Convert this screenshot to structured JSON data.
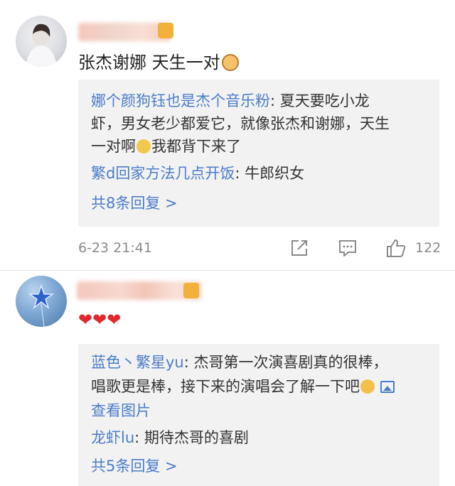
{
  "comment1": {
    "text": "张杰谢娜 天生一对",
    "emoji": "cat-face-emoji",
    "replies": {
      "reply1_name": "娜个颜狗钰也是杰个音乐粉",
      "reply1_line1": ": 夏天要吃小龙",
      "reply1_line2": "虾，男女老少都爱它，就像张杰和谢娜，天生",
      "reply1_line3a": "一对啊",
      "reply1_line3b": "我都背下来了",
      "reply2_name": "繁d回家方法几点开饭",
      "reply2_text": ": 牛郎织女",
      "more": "共8条回复 >"
    },
    "date": "6-23 21:41",
    "like_count": "122"
  },
  "comment2": {
    "text": "❤❤❤",
    "replies": {
      "reply1_name": "蓝色丶繁星yu",
      "reply1_line1": ": 杰哥第一次演喜剧真的很棒，",
      "reply1_line2": "唱歌更是棒，接下来的演唱会了解一下吧",
      "reply1_line3": "查看图片",
      "reply2_name": "龙虾lu",
      "reply2_text": ": 期待杰哥的喜剧",
      "more": "共5条回复 >"
    }
  },
  "colors": {
    "link": "#4b7cc9",
    "heart": "#e0282e",
    "reply_bg": "#f2f2f2",
    "meta": "#8a8a8a"
  }
}
